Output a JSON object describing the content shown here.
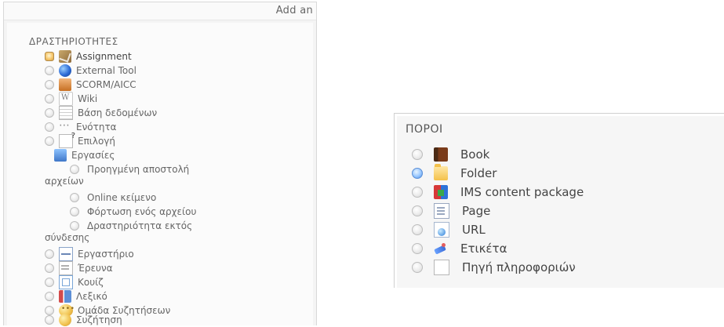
{
  "left_panel": {
    "top_title": "Add an",
    "section_header": "ΔΡΑΣΤΗΡΙΟΤΗΤΕΣ",
    "items": [
      {
        "label": "Assignment",
        "icon": "assignment-icon",
        "selected": true
      },
      {
        "label": "External Tool",
        "icon": "external-tool-icon",
        "selected": false
      },
      {
        "label": "SCORM/AICC",
        "icon": "scorm-icon",
        "selected": false
      },
      {
        "label": "Wiki",
        "icon": "wiki-icon",
        "selected": false
      },
      {
        "label": "Βάση δεδομένων",
        "icon": "database-icon",
        "selected": false
      },
      {
        "label": "Ενότητα",
        "icon": "lesson-icon",
        "selected": false
      },
      {
        "label": "Επιλογή",
        "icon": "choice-icon",
        "selected": false
      }
    ],
    "subgroup": {
      "label": "Εργασίες",
      "icon": "assignments-folder-icon",
      "items": [
        {
          "label_line1": "Προηγμένη αποστολή",
          "label_line2": "αρχείων"
        },
        {
          "label_line1": "Online κείμενο",
          "label_line2": ""
        },
        {
          "label_line1": "Φόρτωση ενός αρχείου",
          "label_line2": ""
        },
        {
          "label_line1": "Δραστηριότητα εκτός",
          "label_line2": "σύνδεσης"
        }
      ]
    },
    "items_after": [
      {
        "label": "Εργαστήριο",
        "icon": "workshop-icon"
      },
      {
        "label": "Έρευνα",
        "icon": "survey-icon"
      },
      {
        "label": "Κουίζ",
        "icon": "quiz-icon"
      },
      {
        "label": "Λεξικό",
        "icon": "glossary-icon"
      },
      {
        "label": "Ομάδα Συζητήσεων",
        "icon": "forum-icon"
      },
      {
        "label": "Συζήτηση",
        "icon": "chat-icon"
      }
    ]
  },
  "right_panel": {
    "section_header": "ΠΟΡΟΙ",
    "items": [
      {
        "label": "Book",
        "icon": "book-icon",
        "selected": false
      },
      {
        "label": "Folder",
        "icon": "folder-icon",
        "selected": true
      },
      {
        "label": "IMS content package",
        "icon": "ims-content-package-icon",
        "selected": false
      },
      {
        "label": "Page",
        "icon": "page-icon",
        "selected": false
      },
      {
        "label": "URL",
        "icon": "url-icon",
        "selected": false
      },
      {
        "label": "Ετικέτα",
        "icon": "label-icon",
        "selected": false
      },
      {
        "label": "Πηγή πληροφοριών",
        "icon": "information-source-icon",
        "selected": false
      }
    ]
  }
}
